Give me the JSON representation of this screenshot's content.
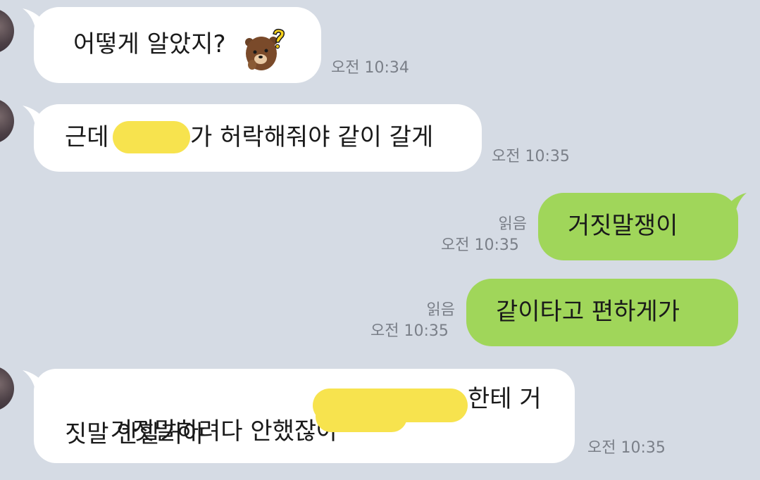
{
  "messages": [
    {
      "side": "in",
      "text": "어떻게 알았지?",
      "sticker": "brown-bear-question-emoji-icon",
      "time": "오전 10:34"
    },
    {
      "side": "in",
      "text_before": "근데",
      "text_after": "가 허락해줘야 같이 갈게",
      "time": "오전 10:35"
    },
    {
      "side": "out",
      "text": "거짓말쟁이",
      "read": "읽음",
      "time": "오전 10:35"
    },
    {
      "side": "out",
      "text": "같이타고 편하게가",
      "read": "읽음",
      "time": "오전 10:35"
    },
    {
      "side": "in",
      "line1_before": "거짓말하려다 안했잖아",
      "line1_after": "한테 거",
      "line2": "짓말 안할거야",
      "time": "오전 10:35"
    }
  ],
  "colors": {
    "background": "#d5dbe4",
    "incoming_bubble": "#ffffff",
    "outgoing_bubble": "#a0d65a",
    "redaction": "#f7e34e",
    "meta_text": "#7a7f88"
  }
}
